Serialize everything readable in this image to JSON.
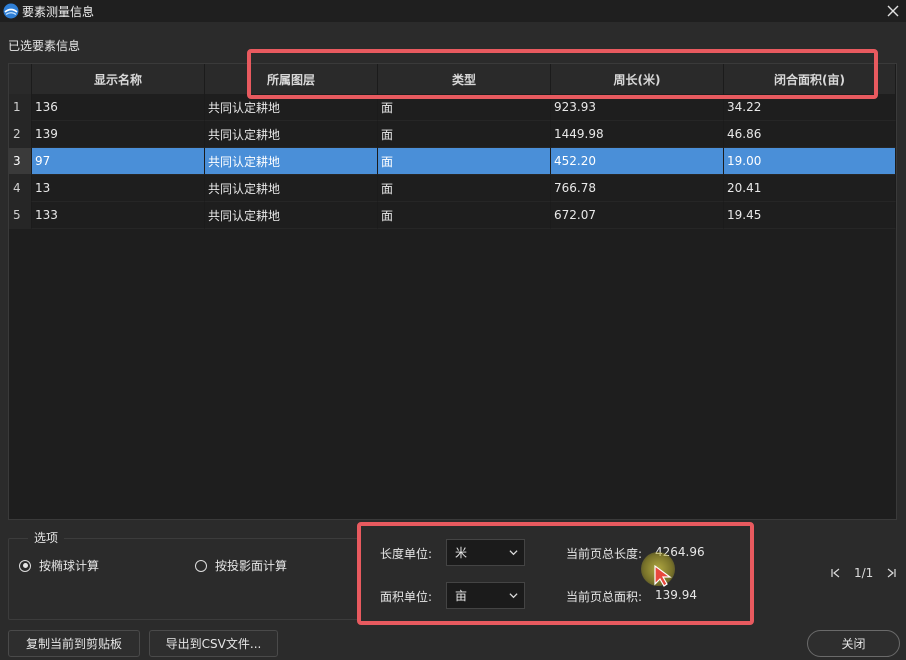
{
  "window": {
    "title": "要素测量信息"
  },
  "section_title": "已选要素信息",
  "table": {
    "columns": [
      "显示名称",
      "所属图层",
      "类型",
      "周长(米)",
      "闭合面积(亩)"
    ],
    "rows": [
      {
        "index": "1",
        "cells": [
          "136",
          "共同认定耕地",
          "面",
          "923.93",
          "34.22"
        ],
        "selected": false
      },
      {
        "index": "2",
        "cells": [
          "139",
          "共同认定耕地",
          "面",
          "1449.98",
          "46.86"
        ],
        "selected": false
      },
      {
        "index": "3",
        "cells": [
          "97",
          "共同认定耕地",
          "面",
          "452.20",
          "19.00"
        ],
        "selected": true
      },
      {
        "index": "4",
        "cells": [
          "13",
          "共同认定耕地",
          "面",
          "766.78",
          "20.41"
        ],
        "selected": false
      },
      {
        "index": "5",
        "cells": [
          "133",
          "共同认定耕地",
          "面",
          "672.07",
          "19.45"
        ],
        "selected": false
      }
    ]
  },
  "options": {
    "legend": "选项",
    "ellipsoid_label": "按椭球计算",
    "projection_label": "按投影面计算",
    "ellipsoid_checked": true
  },
  "units": {
    "length_label": "长度单位:",
    "length_value": "米",
    "area_label": "面积单位:",
    "area_value": "亩",
    "total_length_label": "当前页总长度:",
    "total_length_value": "4264.96",
    "total_area_label": "当前页总面积:",
    "total_area_value": "139.94"
  },
  "pager": {
    "text": "1/1"
  },
  "buttons": {
    "copy": "复制当前到剪贴板",
    "export": "导出到CSV文件...",
    "close": "关闭"
  },
  "colors": {
    "selection": "#4a8fd8",
    "annotation": "#e85a5f",
    "background": "#2b2b2b"
  },
  "icons": {
    "app": "app-logo-icon",
    "window_close": "close-icon",
    "dropdown": "chevron-down-icon",
    "first_page": "first-page-icon",
    "last_page": "last-page-icon"
  }
}
